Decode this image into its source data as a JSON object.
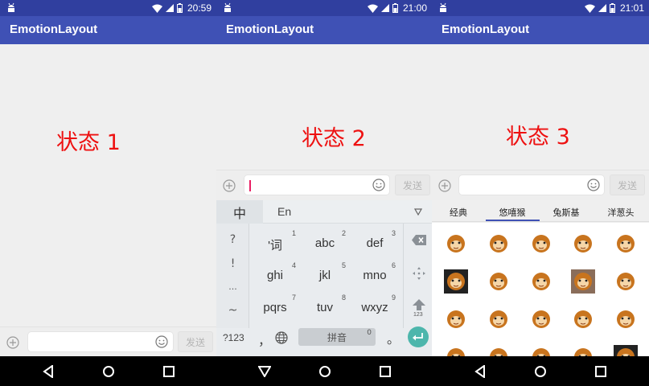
{
  "screens": [
    {
      "status_time": "20:59",
      "app_title": "EmotionLayout",
      "state_label": "状态 1",
      "send_label": "发送"
    },
    {
      "status_time": "21:00",
      "app_title": "EmotionLayout",
      "state_label": "状态 2",
      "send_label": "发送",
      "keyboard": {
        "lang_zh": "中",
        "lang_en": "En",
        "left_keys": [
          "?",
          "!",
          "...",
          "~"
        ],
        "keys": [
          {
            "label": "'词",
            "num": "1"
          },
          {
            "label": "abc",
            "num": "2"
          },
          {
            "label": "def",
            "num": "3"
          },
          {
            "label": "ghi",
            "num": "4"
          },
          {
            "label": "jkl",
            "num": "5"
          },
          {
            "label": "mno",
            "num": "6"
          },
          {
            "label": "pqrs",
            "num": "7"
          },
          {
            "label": "tuv",
            "num": "8"
          },
          {
            "label": "wxyz",
            "num": "9"
          }
        ],
        "num_switch": "?123",
        "comma": "，",
        "space_label": "拼音",
        "space_num": "0",
        "period": "。",
        "shift_num": "123"
      }
    },
    {
      "status_time": "21:01",
      "app_title": "EmotionLayout",
      "state_label": "状态 3",
      "send_label": "发送",
      "emotion_tabs": [
        "经典",
        "悠嘻猴",
        "兔斯基",
        "洋葱头"
      ],
      "active_tab_index": 1
    }
  ],
  "colors": {
    "status_bar": "#303f9f",
    "app_bar": "#3f51b5",
    "state_label": "#ee1111",
    "enter_key": "#4db6ac",
    "cursor": "#e91e63"
  }
}
